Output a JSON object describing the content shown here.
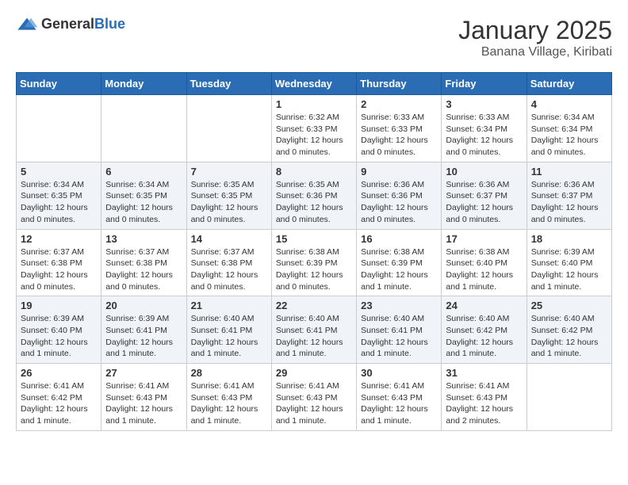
{
  "header": {
    "logo_general": "General",
    "logo_blue": "Blue",
    "month": "January 2025",
    "location": "Banana Village, Kiribati"
  },
  "weekdays": [
    "Sunday",
    "Monday",
    "Tuesday",
    "Wednesday",
    "Thursday",
    "Friday",
    "Saturday"
  ],
  "weeks": [
    [
      {
        "day": "",
        "info": ""
      },
      {
        "day": "",
        "info": ""
      },
      {
        "day": "",
        "info": ""
      },
      {
        "day": "1",
        "info": "Sunrise: 6:32 AM\nSunset: 6:33 PM\nDaylight: 12 hours and 0 minutes."
      },
      {
        "day": "2",
        "info": "Sunrise: 6:33 AM\nSunset: 6:33 PM\nDaylight: 12 hours and 0 minutes."
      },
      {
        "day": "3",
        "info": "Sunrise: 6:33 AM\nSunset: 6:34 PM\nDaylight: 12 hours and 0 minutes."
      },
      {
        "day": "4",
        "info": "Sunrise: 6:34 AM\nSunset: 6:34 PM\nDaylight: 12 hours and 0 minutes."
      }
    ],
    [
      {
        "day": "5",
        "info": "Sunrise: 6:34 AM\nSunset: 6:35 PM\nDaylight: 12 hours and 0 minutes."
      },
      {
        "day": "6",
        "info": "Sunrise: 6:34 AM\nSunset: 6:35 PM\nDaylight: 12 hours and 0 minutes."
      },
      {
        "day": "7",
        "info": "Sunrise: 6:35 AM\nSunset: 6:35 PM\nDaylight: 12 hours and 0 minutes."
      },
      {
        "day": "8",
        "info": "Sunrise: 6:35 AM\nSunset: 6:36 PM\nDaylight: 12 hours and 0 minutes."
      },
      {
        "day": "9",
        "info": "Sunrise: 6:36 AM\nSunset: 6:36 PM\nDaylight: 12 hours and 0 minutes."
      },
      {
        "day": "10",
        "info": "Sunrise: 6:36 AM\nSunset: 6:37 PM\nDaylight: 12 hours and 0 minutes."
      },
      {
        "day": "11",
        "info": "Sunrise: 6:36 AM\nSunset: 6:37 PM\nDaylight: 12 hours and 0 minutes."
      }
    ],
    [
      {
        "day": "12",
        "info": "Sunrise: 6:37 AM\nSunset: 6:38 PM\nDaylight: 12 hours and 0 minutes."
      },
      {
        "day": "13",
        "info": "Sunrise: 6:37 AM\nSunset: 6:38 PM\nDaylight: 12 hours and 0 minutes."
      },
      {
        "day": "14",
        "info": "Sunrise: 6:37 AM\nSunset: 6:38 PM\nDaylight: 12 hours and 0 minutes."
      },
      {
        "day": "15",
        "info": "Sunrise: 6:38 AM\nSunset: 6:39 PM\nDaylight: 12 hours and 0 minutes."
      },
      {
        "day": "16",
        "info": "Sunrise: 6:38 AM\nSunset: 6:39 PM\nDaylight: 12 hours and 1 minute."
      },
      {
        "day": "17",
        "info": "Sunrise: 6:38 AM\nSunset: 6:40 PM\nDaylight: 12 hours and 1 minute."
      },
      {
        "day": "18",
        "info": "Sunrise: 6:39 AM\nSunset: 6:40 PM\nDaylight: 12 hours and 1 minute."
      }
    ],
    [
      {
        "day": "19",
        "info": "Sunrise: 6:39 AM\nSunset: 6:40 PM\nDaylight: 12 hours and 1 minute."
      },
      {
        "day": "20",
        "info": "Sunrise: 6:39 AM\nSunset: 6:41 PM\nDaylight: 12 hours and 1 minute."
      },
      {
        "day": "21",
        "info": "Sunrise: 6:40 AM\nSunset: 6:41 PM\nDaylight: 12 hours and 1 minute."
      },
      {
        "day": "22",
        "info": "Sunrise: 6:40 AM\nSunset: 6:41 PM\nDaylight: 12 hours and 1 minute."
      },
      {
        "day": "23",
        "info": "Sunrise: 6:40 AM\nSunset: 6:41 PM\nDaylight: 12 hours and 1 minute."
      },
      {
        "day": "24",
        "info": "Sunrise: 6:40 AM\nSunset: 6:42 PM\nDaylight: 12 hours and 1 minute."
      },
      {
        "day": "25",
        "info": "Sunrise: 6:40 AM\nSunset: 6:42 PM\nDaylight: 12 hours and 1 minute."
      }
    ],
    [
      {
        "day": "26",
        "info": "Sunrise: 6:41 AM\nSunset: 6:42 PM\nDaylight: 12 hours and 1 minute."
      },
      {
        "day": "27",
        "info": "Sunrise: 6:41 AM\nSunset: 6:43 PM\nDaylight: 12 hours and 1 minute."
      },
      {
        "day": "28",
        "info": "Sunrise: 6:41 AM\nSunset: 6:43 PM\nDaylight: 12 hours and 1 minute."
      },
      {
        "day": "29",
        "info": "Sunrise: 6:41 AM\nSunset: 6:43 PM\nDaylight: 12 hours and 1 minute."
      },
      {
        "day": "30",
        "info": "Sunrise: 6:41 AM\nSunset: 6:43 PM\nDaylight: 12 hours and 1 minute."
      },
      {
        "day": "31",
        "info": "Sunrise: 6:41 AM\nSunset: 6:43 PM\nDaylight: 12 hours and 2 minutes."
      },
      {
        "day": "",
        "info": ""
      }
    ]
  ]
}
